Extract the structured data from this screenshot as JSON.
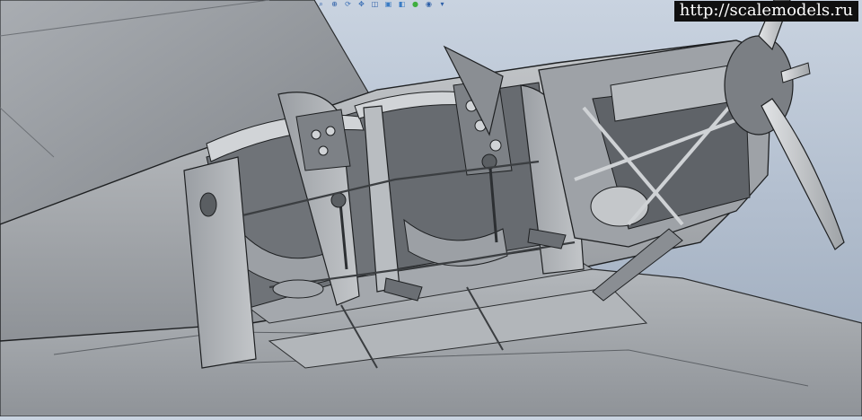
{
  "app": {
    "watermark_text": "http://scalemodels.ru"
  },
  "toolbar": {
    "buttons": [
      {
        "name": "zoom-fit-icon",
        "glyph": "⌕",
        "color": "#2d5fa8"
      },
      {
        "name": "zoom-in-icon",
        "glyph": "⊕",
        "color": "#2d5fa8"
      },
      {
        "name": "rotate-view-icon",
        "glyph": "⟳",
        "color": "#3a6fb5"
      },
      {
        "name": "pan-icon",
        "glyph": "✥",
        "color": "#3a6fb5"
      },
      {
        "name": "view-orientation-icon",
        "glyph": "◫",
        "color": "#2d5fa8"
      },
      {
        "name": "display-style-icon",
        "glyph": "▣",
        "color": "#3b7cc4"
      },
      {
        "name": "section-view-icon",
        "glyph": "◧",
        "color": "#3b7cc4"
      },
      {
        "name": "appearance-icon",
        "glyph": "●",
        "color": "#3fae3f"
      },
      {
        "name": "scene-icon",
        "glyph": "◉",
        "color": "#2d5fa8"
      },
      {
        "name": "view-settings-icon",
        "glyph": "▾",
        "color": "#2d5fa8"
      }
    ]
  },
  "colors": {
    "background_top": "#c9d3e0",
    "background_bottom": "#9aa7b8",
    "model_light": "#b8bcc0",
    "model_mid": "#8d9196",
    "model_dark": "#4a4e52",
    "edge": "#1e2022"
  }
}
